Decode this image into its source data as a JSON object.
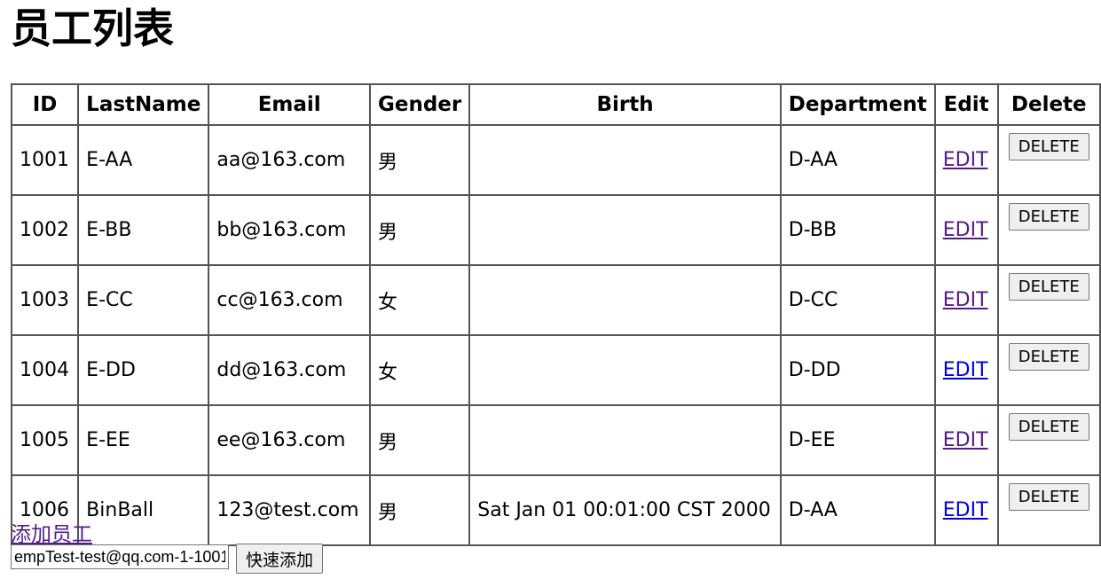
{
  "page": {
    "title": "员工列表"
  },
  "table": {
    "headers": {
      "id": "ID",
      "last_name": "LastName",
      "email": "Email",
      "gender": "Gender",
      "birth": "Birth",
      "department": "Department",
      "edit": "Edit",
      "delete": "Delete"
    },
    "rows": [
      {
        "id": "1001",
        "last_name": "E-AA",
        "email": "aa@163.com",
        "gender": "男",
        "birth": "",
        "department": "D-AA",
        "edit": "EDIT",
        "delete": "DELETE",
        "edit_visited": true
      },
      {
        "id": "1002",
        "last_name": "E-BB",
        "email": "bb@163.com",
        "gender": "男",
        "birth": "",
        "department": "D-BB",
        "edit": "EDIT",
        "delete": "DELETE",
        "edit_visited": true
      },
      {
        "id": "1003",
        "last_name": "E-CC",
        "email": "cc@163.com",
        "gender": "女",
        "birth": "",
        "department": "D-CC",
        "edit": "EDIT",
        "delete": "DELETE",
        "edit_visited": true
      },
      {
        "id": "1004",
        "last_name": "E-DD",
        "email": "dd@163.com",
        "gender": "女",
        "birth": "",
        "department": "D-DD",
        "edit": "EDIT",
        "delete": "DELETE",
        "edit_visited": false
      },
      {
        "id": "1005",
        "last_name": "E-EE",
        "email": "ee@163.com",
        "gender": "男",
        "birth": "",
        "department": "D-EE",
        "edit": "EDIT",
        "delete": "DELETE",
        "edit_visited": true
      },
      {
        "id": "1006",
        "last_name": "BinBall",
        "email": "123@test.com",
        "gender": "男",
        "birth": "Sat Jan 01 00:01:00 CST 2000",
        "department": "D-AA",
        "edit": "EDIT",
        "delete": "DELETE",
        "edit_visited": false
      }
    ]
  },
  "add_link": {
    "label": "添加员工"
  },
  "quick_add": {
    "input_value": "empTest-test@qq.com-1-1001",
    "button_label": "快速添加"
  },
  "colors": {
    "visited_link": "#551a8b",
    "unvisited_link": "#0000ee",
    "border": "#555555"
  }
}
